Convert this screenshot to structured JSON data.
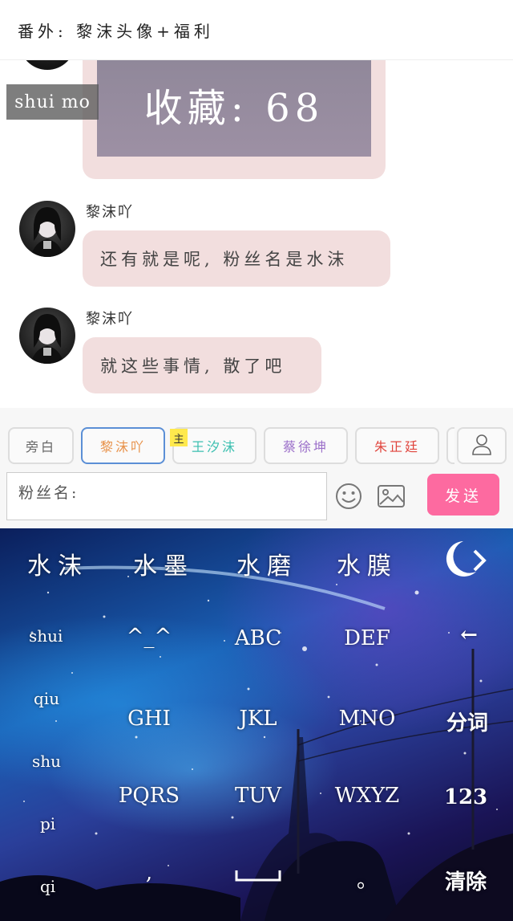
{
  "header": {
    "title": "番外: 黎沫头像+福利"
  },
  "chat": {
    "image_text": "收藏: 68",
    "messages": [
      {
        "sender": "黎沫吖",
        "text": "还有就是呢, 粉丝名是水沫"
      },
      {
        "sender": "黎沫吖",
        "text": "就这些事情, 散了吧"
      }
    ]
  },
  "roles": [
    {
      "label": "旁白",
      "color": "#666666"
    },
    {
      "label": "黎沫吖",
      "color": "#e8924a"
    },
    {
      "label": "王汐沫",
      "color": "#3bbfb0"
    },
    {
      "label": "蔡徐坤",
      "color": "#9b6fc9"
    },
    {
      "label": "朱正廷",
      "color": "#e0443c"
    }
  ],
  "host_badge": "主",
  "input": {
    "value": "粉丝名:"
  },
  "send_label": "发送",
  "ime": {
    "composing": "shui mo",
    "candidates": [
      "水沫",
      "水墨",
      "水磨",
      "水膜"
    ],
    "pinyin": [
      "shui",
      "qiu",
      "shu",
      "pi",
      "qi"
    ],
    "keys": {
      "symbols": "^_^",
      "abc": "ABC",
      "def": "DEF",
      "ghi": "GHI",
      "jkl": "JKL",
      "mno": "MNO",
      "pqrs": "PQRS",
      "tuv": "TUV",
      "wxyz": "WXYZ",
      "comma": ",",
      "period": "。",
      "backspace": "←",
      "segment": "分词",
      "numbers": "123",
      "clear": "清除"
    }
  },
  "colors": {
    "accent": "#fd6aa0",
    "bubble": "#f2dede",
    "selected_border": "#5b8fd6"
  }
}
